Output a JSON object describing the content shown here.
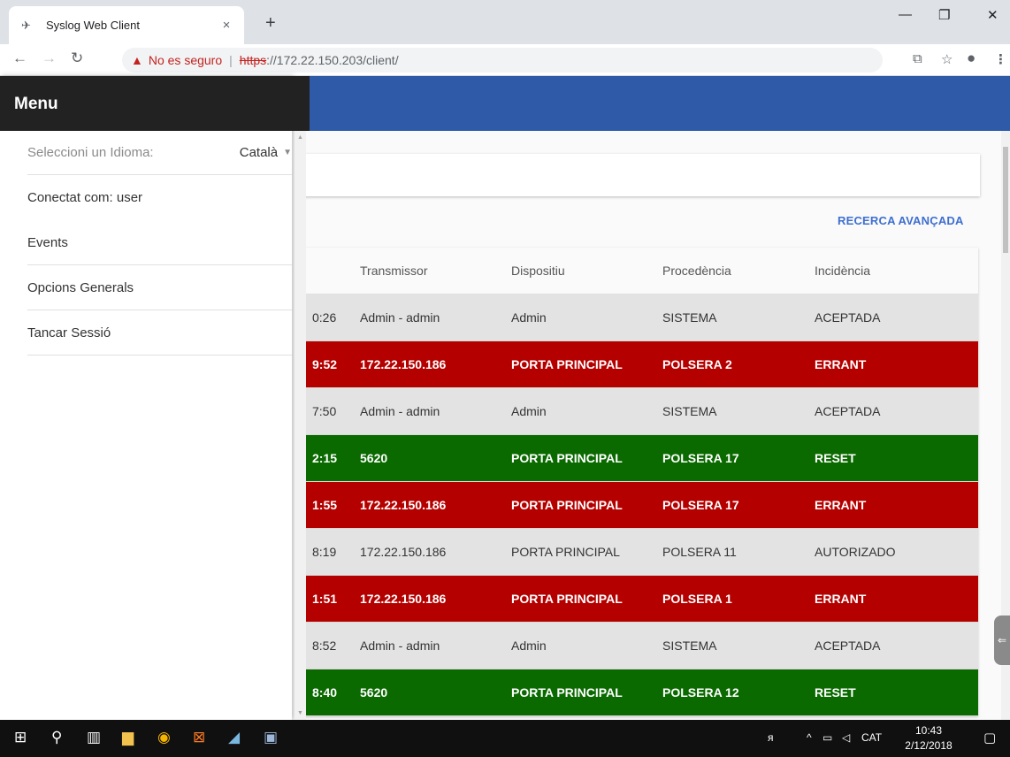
{
  "browser": {
    "tab_title": "Syslog Web Client",
    "tab_close": "×",
    "new_tab": "+",
    "security_text": "No es seguro",
    "separator": "|",
    "url_scheme": "https",
    "url_rest": "://172.22.150.203/client/"
  },
  "drawer": {
    "title": "Menu",
    "language_label": "Seleccioni un Idioma:",
    "language_value": "Català",
    "items": [
      {
        "label": "Conectat com: user"
      },
      {
        "label": "Events"
      },
      {
        "label": "Opcions Generals"
      },
      {
        "label": "Tancar Sessió"
      }
    ]
  },
  "main": {
    "advanced_search": "RECERCA AVANÇADA",
    "headers": [
      "Transmissor",
      "Dispositiu",
      "Procedència",
      "Incidència"
    ],
    "rows": [
      {
        "time": "0:26",
        "transmitter": "Admin - admin",
        "device": "Admin",
        "origin": "SISTEMA",
        "incident": "ACEPTADA",
        "status": "grey"
      },
      {
        "time": "9:52",
        "transmitter": "172.22.150.186",
        "device": "PORTA PRINCIPAL",
        "origin": "POLSERA 2",
        "incident": "ERRANT",
        "status": "red"
      },
      {
        "time": "7:50",
        "transmitter": "Admin - admin",
        "device": "Admin",
        "origin": "SISTEMA",
        "incident": "ACEPTADA",
        "status": "grey"
      },
      {
        "time": "2:15",
        "transmitter": "5620",
        "device": "PORTA PRINCIPAL",
        "origin": "POLSERA 17",
        "incident": "RESET",
        "status": "green"
      },
      {
        "time": "1:55",
        "transmitter": "172.22.150.186",
        "device": "PORTA PRINCIPAL",
        "origin": "POLSERA 17",
        "incident": "ERRANT",
        "status": "red"
      },
      {
        "time": "8:19",
        "transmitter": "172.22.150.186",
        "device": "PORTA PRINCIPAL",
        "origin": "POLSERA 11",
        "incident": "AUTORIZADO",
        "status": "grey"
      },
      {
        "time": "1:51",
        "transmitter": "172.22.150.186",
        "device": "PORTA PRINCIPAL",
        "origin": "POLSERA 1",
        "incident": "ERRANT",
        "status": "red"
      },
      {
        "time": "8:52",
        "transmitter": "Admin - admin",
        "device": "Admin",
        "origin": "SISTEMA",
        "incident": "ACEPTADA",
        "status": "grey"
      },
      {
        "time": "8:40",
        "transmitter": "5620",
        "device": "PORTA PRINCIPAL",
        "origin": "POLSERA 12",
        "incident": "RESET",
        "status": "green"
      }
    ]
  },
  "taskbar": {
    "tray_lang": "CAT",
    "time": "10:43",
    "date": "2/12/2018"
  },
  "colors": {
    "appbar": "#2f5aa8",
    "drawer_header": "#222222",
    "row_red": "#b50000",
    "row_green": "#0a6a00",
    "row_grey": "#e3e3e3",
    "link": "#3d6fd0"
  }
}
